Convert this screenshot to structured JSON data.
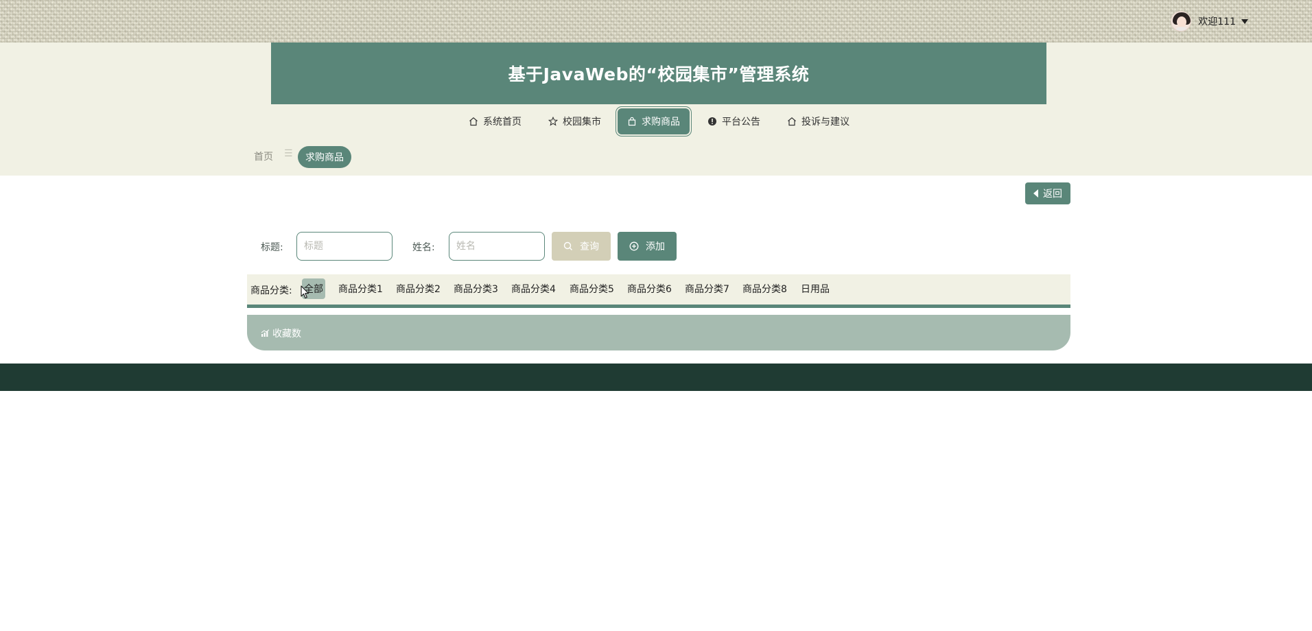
{
  "header": {
    "welcome": "欢迎111",
    "title": "基于JavaWeb的“校园集市”管理系统"
  },
  "nav": {
    "items": [
      {
        "label": "系统首页",
        "icon": "home-icon"
      },
      {
        "label": "校园集市",
        "icon": "star-icon"
      },
      {
        "label": "求购商品",
        "icon": "bag-icon",
        "active": true
      },
      {
        "label": "平台公告",
        "icon": "exclamation-icon"
      },
      {
        "label": "投诉与建议",
        "icon": "home-icon"
      }
    ]
  },
  "breadcrumb": {
    "home": "首页",
    "separator": "☰",
    "current": "求购商品"
  },
  "actions": {
    "back_label": "返回"
  },
  "search": {
    "title_label": "标题:",
    "title_placeholder": "标题",
    "title_value": "",
    "name_label": "姓名:",
    "name_placeholder": "姓名",
    "name_value": "",
    "query_label": "查询",
    "add_label": "添加"
  },
  "category": {
    "label": "商品分类:",
    "items": [
      "全部",
      "商品分类1",
      "商品分类2",
      "商品分类3",
      "商品分类4",
      "商品分类5",
      "商品分类6",
      "商品分类7",
      "商品分类8",
      "日用品"
    ],
    "selected": "全部"
  },
  "sort": {
    "label": "收藏数",
    "icon": "chart-icon"
  },
  "colors": {
    "primary": "#5a8679",
    "band": "#f1f1e4",
    "query": "#d3cfb7",
    "sort": "#a6bbb0",
    "footer": "#1f3b33"
  }
}
